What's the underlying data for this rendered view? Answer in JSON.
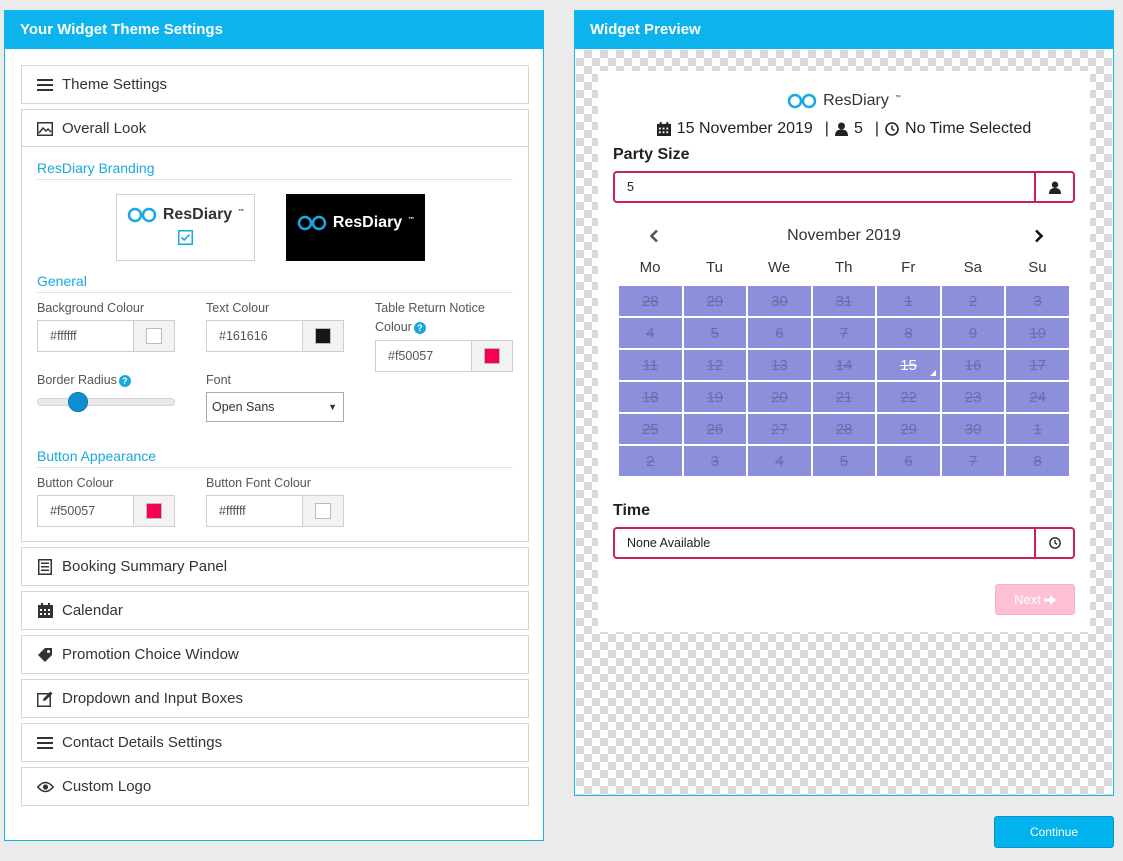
{
  "left_panel": {
    "title": "Your Widget Theme Settings",
    "sections": {
      "theme_settings": "Theme Settings",
      "overall_look": "Overall Look",
      "booking_summary": "Booking Summary Panel",
      "calendar": "Calendar",
      "promotion_choice": "Promotion Choice Window",
      "dropdown_input": "Dropdown and Input Boxes",
      "contact_details": "Contact Details Settings",
      "custom_logo": "Custom Logo"
    },
    "overall_look": {
      "branding_title": "ResDiary Branding",
      "brand_name": "ResDiary",
      "tm": "™",
      "general_title": "General",
      "background_colour": {
        "label": "Background Colour",
        "value": "#ffffff",
        "swatch": "#ffffff"
      },
      "text_colour": {
        "label": "Text Colour",
        "value": "#161616",
        "swatch": "#161616"
      },
      "table_return": {
        "label_line1": "Table Return Notice",
        "label_line2": "Colour",
        "value": "#f50057",
        "swatch": "#f50057"
      },
      "border_radius_label": "Border Radius",
      "border_radius_level": 0.25,
      "font": {
        "label": "Font",
        "value": "Open Sans"
      },
      "button_title": "Button Appearance",
      "button_colour": {
        "label": "Button Colour",
        "value": "#f50057",
        "swatch": "#f50057"
      },
      "button_font_colour": {
        "label": "Button Font Colour",
        "value": "#ffffff",
        "swatch": "#ffffff"
      },
      "help_glyph": "?"
    }
  },
  "right_panel": {
    "title": "Widget Preview",
    "widget": {
      "brand_name": "ResDiary",
      "tm": "™",
      "summary_date": "15 November 2019",
      "summary_sep": "|",
      "summary_party": "5",
      "summary_time": "No Time Selected",
      "party_label": "Party Size",
      "party_value": "5",
      "calendar": {
        "month": "November 2019",
        "prev": "‹",
        "next": "›",
        "days": [
          "Mo",
          "Tu",
          "We",
          "Th",
          "Fr",
          "Sa",
          "Su"
        ],
        "weeks": [
          [
            "28",
            "29",
            "30",
            "31",
            "1",
            "2",
            "3"
          ],
          [
            "4",
            "5",
            "6",
            "7",
            "8",
            "9",
            "10"
          ],
          [
            "11",
            "12",
            "13",
            "14",
            "15",
            "16",
            "17"
          ],
          [
            "18",
            "19",
            "20",
            "21",
            "22",
            "23",
            "24"
          ],
          [
            "25",
            "26",
            "27",
            "28",
            "29",
            "30",
            "1"
          ],
          [
            "2",
            "3",
            "4",
            "5",
            "6",
            "7",
            "8"
          ]
        ],
        "selected": "15"
      },
      "time_label": "Time",
      "time_value": "None Available",
      "next_label": "Next"
    }
  },
  "continue_label": "Continue",
  "colors": {
    "accent": "#0db3ec",
    "input_border": "#c8205a",
    "calendar_cell": "#8c90dc",
    "next_button": "#ffc0d4"
  }
}
